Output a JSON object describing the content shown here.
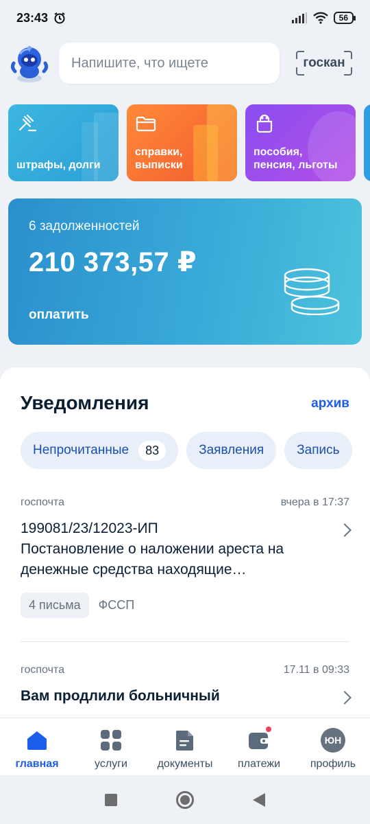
{
  "status_bar": {
    "time": "23:43",
    "battery": "56",
    "icons": [
      "alarm-icon",
      "signal-icon",
      "wifi-icon",
      "battery-icon"
    ]
  },
  "search": {
    "placeholder": "Напишите, что ищете",
    "scan_label": "госкан"
  },
  "categories": [
    {
      "label": "штрафы, долги",
      "icon": "gavel-icon"
    },
    {
      "label": "справки, выписки",
      "icon": "folder-icon"
    },
    {
      "label": "пособия, пенсия, льготы",
      "icon": "wallet-icon"
    }
  ],
  "debt": {
    "count_text": "6 задолженностей",
    "amount": "210 373,57 ₽",
    "pay_label": "оплатить"
  },
  "notifications": {
    "title": "Уведомления",
    "archive_label": "архив",
    "filters": [
      {
        "label": "Непрочитанные",
        "count": "83"
      },
      {
        "label": "Заявления"
      },
      {
        "label": "Запись"
      }
    ],
    "items": [
      {
        "source": "госпочта",
        "time": "вчера в 17:37",
        "title": "199081/23/12023-ИП\nПостановление о наложении ареста на денежные средства находящие…",
        "letters": "4 письма",
        "org": "ФССП"
      },
      {
        "source": "госпочта",
        "time": "17.11 в 09:33",
        "title": "Вам продлили больничный"
      }
    ]
  },
  "bottom_nav": [
    {
      "label": "главная",
      "icon": "home-icon",
      "active": true
    },
    {
      "label": "услуги",
      "icon": "grid-icon"
    },
    {
      "label": "документы",
      "icon": "document-icon"
    },
    {
      "label": "платежи",
      "icon": "wallet-icon"
    },
    {
      "label": "профиль",
      "icon": "avatar",
      "initials": "ЮН"
    }
  ],
  "colors": {
    "accent": "#1d5deb",
    "card_blue": "#2a9fd6",
    "card_orange": "#f25a2f",
    "card_purple": "#8a4ef0",
    "debt": "#39aad8",
    "notification_dot": "#ee3f58"
  }
}
